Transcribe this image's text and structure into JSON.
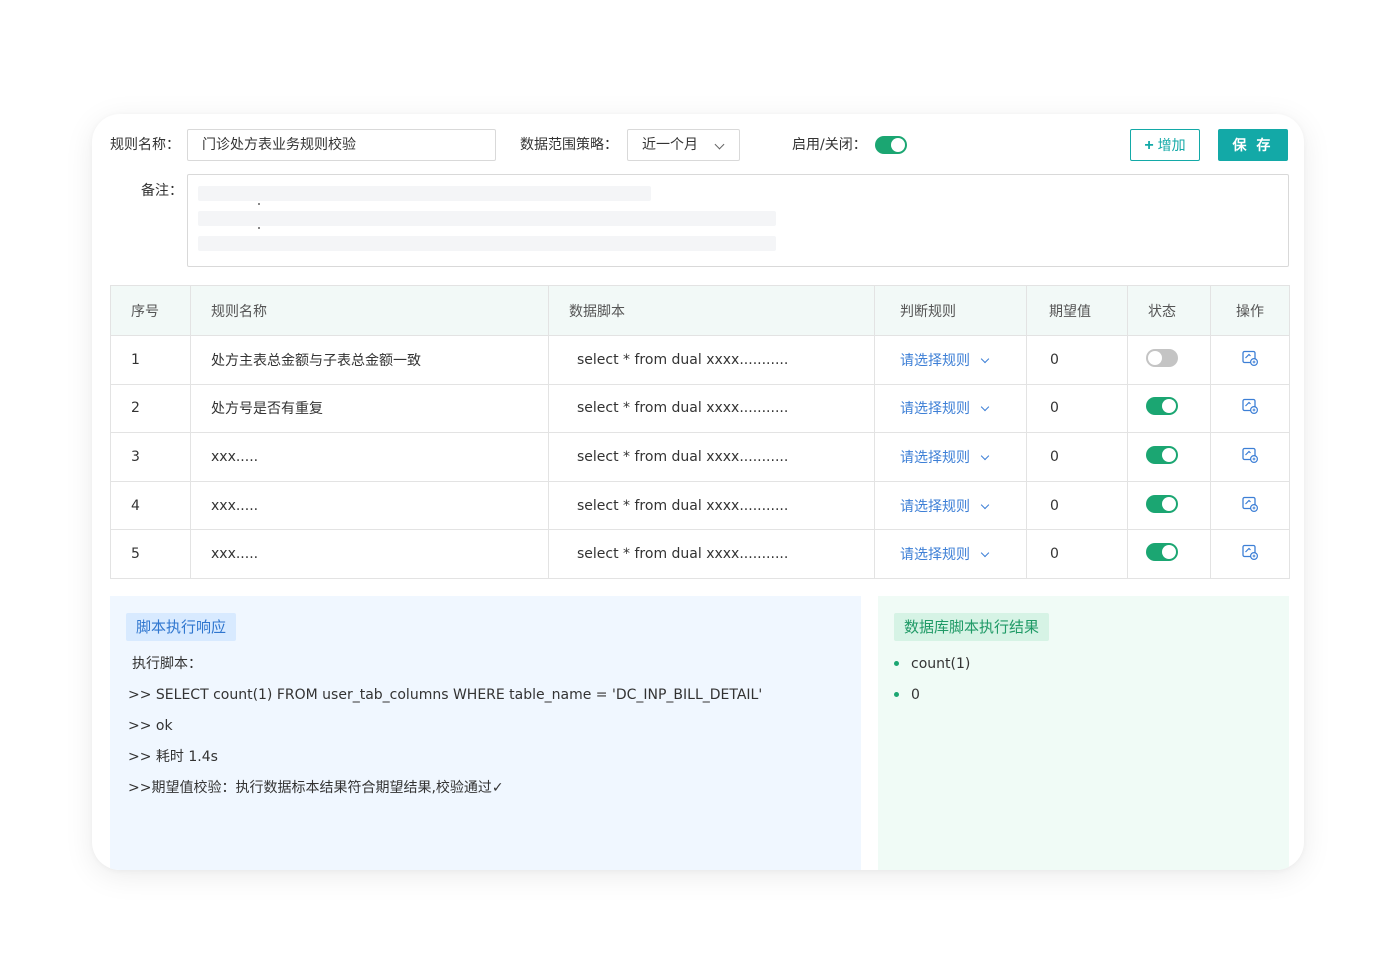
{
  "form": {
    "rule_name_label": "规则名称：",
    "rule_name_value": "门诊处方表业务规则校验",
    "scope_label": "数据范围策略：",
    "scope_value": "近一个月",
    "enable_label": "启用/关闭：",
    "enable_on": true,
    "remark_label": "备注：",
    "add_button": "增加",
    "save_button": "保 存"
  },
  "table": {
    "headers": [
      "序号",
      "规则名称",
      "数据脚本",
      "判断规则",
      "期望值",
      "状态",
      "操作"
    ],
    "rows": [
      {
        "no": "1",
        "name": "处方主表总金额与子表总金额一致",
        "script": "select * from dual xxxx...........",
        "rule": "请选择规则",
        "expect": "0",
        "status_on": false
      },
      {
        "no": "2",
        "name": "处方号是否有重复",
        "script": "select * from dual xxxx...........",
        "rule": "请选择规则",
        "expect": "0",
        "status_on": true
      },
      {
        "no": "3",
        "name": "xxx.....",
        "script": "select * from dual xxxx...........",
        "rule": "请选择规则",
        "expect": "0",
        "status_on": true
      },
      {
        "no": "4",
        "name": "xxx.....",
        "script": "select * from dual xxxx...........",
        "rule": "请选择规则",
        "expect": "0",
        "status_on": true
      },
      {
        "no": "5",
        "name": "xxx.....",
        "script": "select * from dual xxxx...........",
        "rule": "请选择规则",
        "expect": "0",
        "status_on": true
      }
    ]
  },
  "response_panel": {
    "title": "脚本执行响应",
    "lines": [
      "执行脚本：",
      ">> SELECT count(1) FROM user_tab_columns WHERE  table_name = 'DC_INP_BILL_DETAIL'",
      ">> ok",
      ">> 耗时 1.4s",
      ">>期望值校验：执行数据标本结果符合期望结果,校验通过✓"
    ]
  },
  "result_panel": {
    "title": "数据库脚本执行结果",
    "items": [
      "count(1)",
      "0"
    ]
  },
  "colors": {
    "primary": "#13a9a7",
    "toggle_on": "#1ba672",
    "link": "#3d7fd6"
  },
  "icons": {
    "add": "plus-icon",
    "select": "chevron-down-icon",
    "edit": "edit-icon"
  }
}
